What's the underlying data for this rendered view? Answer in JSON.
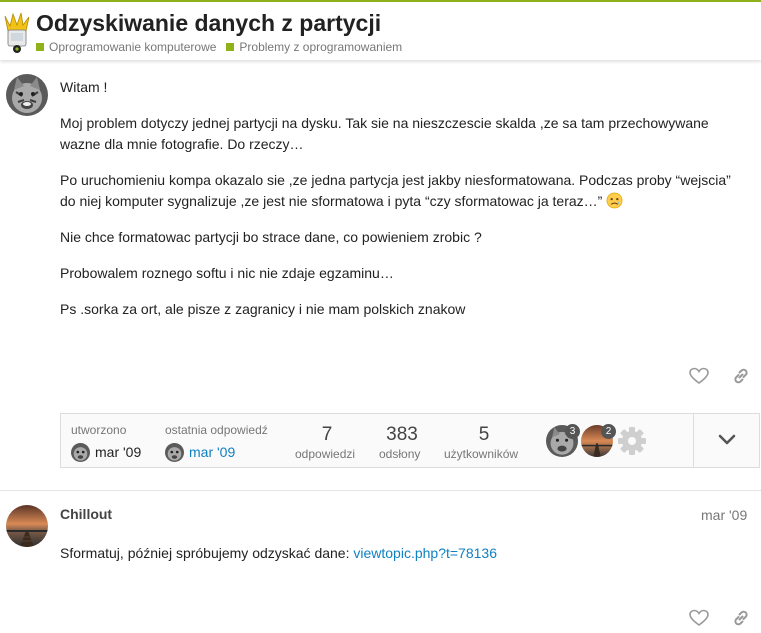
{
  "topic": {
    "title": "Odzyskiwanie danych z partycji",
    "categories": [
      {
        "label": "Oprogramowanie komputerowe",
        "color": "#8fb21b"
      },
      {
        "label": "Problemy z oprogramowaniem",
        "color": "#8fb21b"
      }
    ]
  },
  "post1": {
    "paragraphs": [
      "Witam !",
      "Moj problem dotyczy jednej partycji na dysku. Tak sie na nieszczescie skalda ,ze sa tam przechowywane wazne dla mnie fotografie. Do rzeczy…",
      "Po uruchomieniu kompa okazalo sie ,ze jedna partycja jest jakby niesformatowana. Podczas proby “wejscia” do niej komputer sygnalizuje ,ze jest nie sformatowa i pyta “czy sformatowac ja teraz…”",
      "Nie chce formatowac partycji bo strace dane, co powieniem zrobic ?",
      "Probowalem roznego softu i nic nie zdaje egzaminu…",
      "Ps .sorka za ort, ale pisze z zagranicy i nie mam polskich znakow"
    ],
    "emoji_name": "sad-face-emoji"
  },
  "topic_map": {
    "created_label": "utworzono",
    "created_date": "mar '09",
    "last_reply_label": "ostatnia odpowiedź",
    "last_reply_date": "mar '09",
    "replies": "7",
    "replies_label": "odpowiedzi",
    "views": "383",
    "views_label": "odsłony",
    "users": "5",
    "users_label": "użytkowników",
    "participants": [
      {
        "count": "3"
      },
      {
        "count": "2"
      }
    ]
  },
  "post2": {
    "username": "Chillout",
    "date": "mar '09",
    "text": "Sformatuj, później spróbujemy odzyskać dane: ",
    "link_text": "viewtopic.php?t=78136"
  },
  "colors": {
    "accent": "#8fb21b",
    "link": "#0f81c2"
  }
}
